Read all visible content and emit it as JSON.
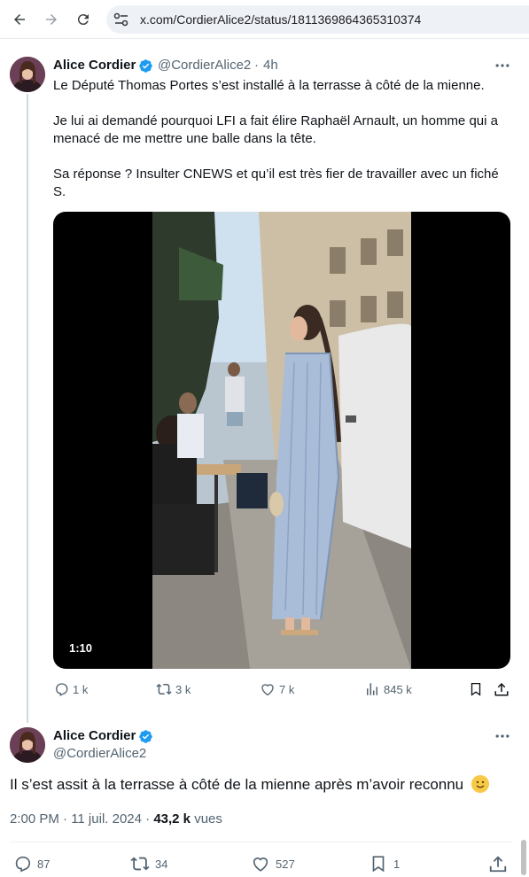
{
  "browser": {
    "url": "x.com/CordierAlice2/status/1811369864365310374",
    "icons": [
      "back-arrow-icon",
      "forward-arrow-icon",
      "reload-icon",
      "site-settings-icon"
    ]
  },
  "tweet": {
    "author_name": "Alice Cordier",
    "handle": "@CordierAlice2",
    "time": "4h",
    "separator": "·",
    "paragraphs": [
      "Le Député Thomas Portes s’est installé à la terrasse à côté de la mienne.",
      "Je lui ai demandé pourquoi LFI a fait élire  Raphaël Arnault, un homme qui a menacé de me mettre une balle dans la tête.",
      "Sa réponse ? Insulter CNEWS et qu’il est très fier de travailler avec un fiché S."
    ],
    "video_duration": "1:10",
    "stats": {
      "replies": "1 k",
      "reposts": "3 k",
      "likes": "7 k",
      "views": "845 k"
    }
  },
  "reply": {
    "author_name": "Alice Cordier",
    "handle": "@CordierAlice2",
    "text": "Il s’est assit à la terrasse à côté de la mienne après m’avoir reconnu",
    "emoji": "slightly-smiling-face",
    "timestamp": "2:00 PM · 11 juil. 2024 · ",
    "views_count": "43,2 k",
    "views_label": " vues",
    "stats": {
      "replies": "87",
      "reposts": "34",
      "likes": "527",
      "bookmarks": "1"
    }
  },
  "colors": {
    "verified": "#1d9bf0",
    "muted": "#536471",
    "text": "#0f1419"
  }
}
